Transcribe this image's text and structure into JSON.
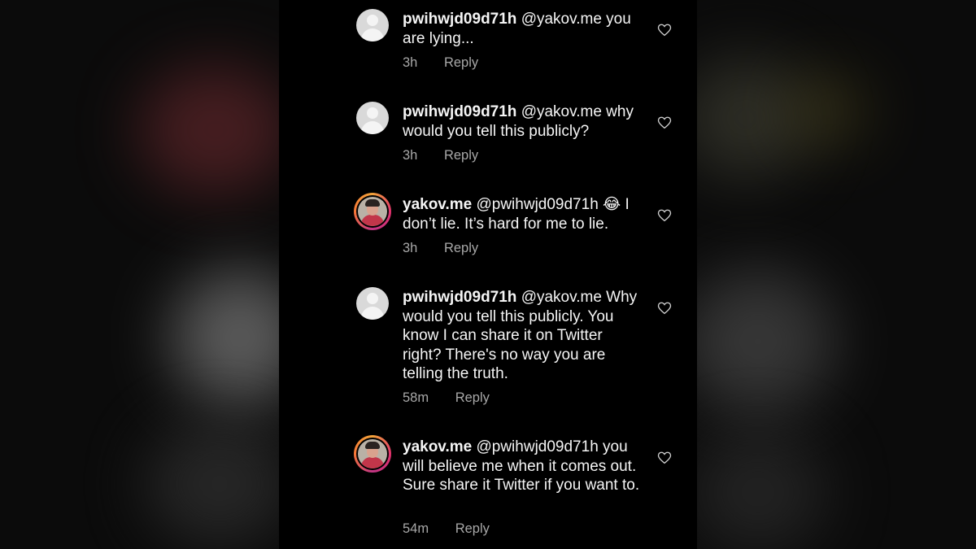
{
  "comments": [
    {
      "username": "pwihwjd09d71h",
      "avatar": "default-avatar",
      "text": "@yakov.me you are lying...",
      "time": "3h",
      "reply_label": "Reply"
    },
    {
      "username": "pwihwjd09d71h",
      "avatar": "default-avatar",
      "text": "@yakov.me why would you tell this publicly?",
      "time": "3h",
      "reply_label": "Reply"
    },
    {
      "username": "yakov.me",
      "avatar": "profile-photo",
      "text_before_emoji": "@pwihwjd09d71h ",
      "emoji": "😂",
      "text_after_emoji": " I don’t lie. It’s hard for me to lie.",
      "time": "3h",
      "reply_label": "Reply"
    },
    {
      "username": "pwihwjd09d71h",
      "avatar": "default-avatar",
      "text": "@yakov.me Why would you tell this publicly. You know I can share it on Twitter right? There's no way you are telling the truth.",
      "time": "58m",
      "reply_label": "Reply"
    },
    {
      "username": "yakov.me",
      "avatar": "profile-photo",
      "text": "@pwihwjd09d71h you will believe me when it comes out. Sure share it Twitter if you want to.",
      "time": "54m",
      "reply_label": "Reply"
    }
  ],
  "icons": {
    "like": "heart-outline-icon"
  },
  "colors": {
    "background": "#000000",
    "text": "#f5f5f5",
    "meta": "#a8a8a8"
  }
}
